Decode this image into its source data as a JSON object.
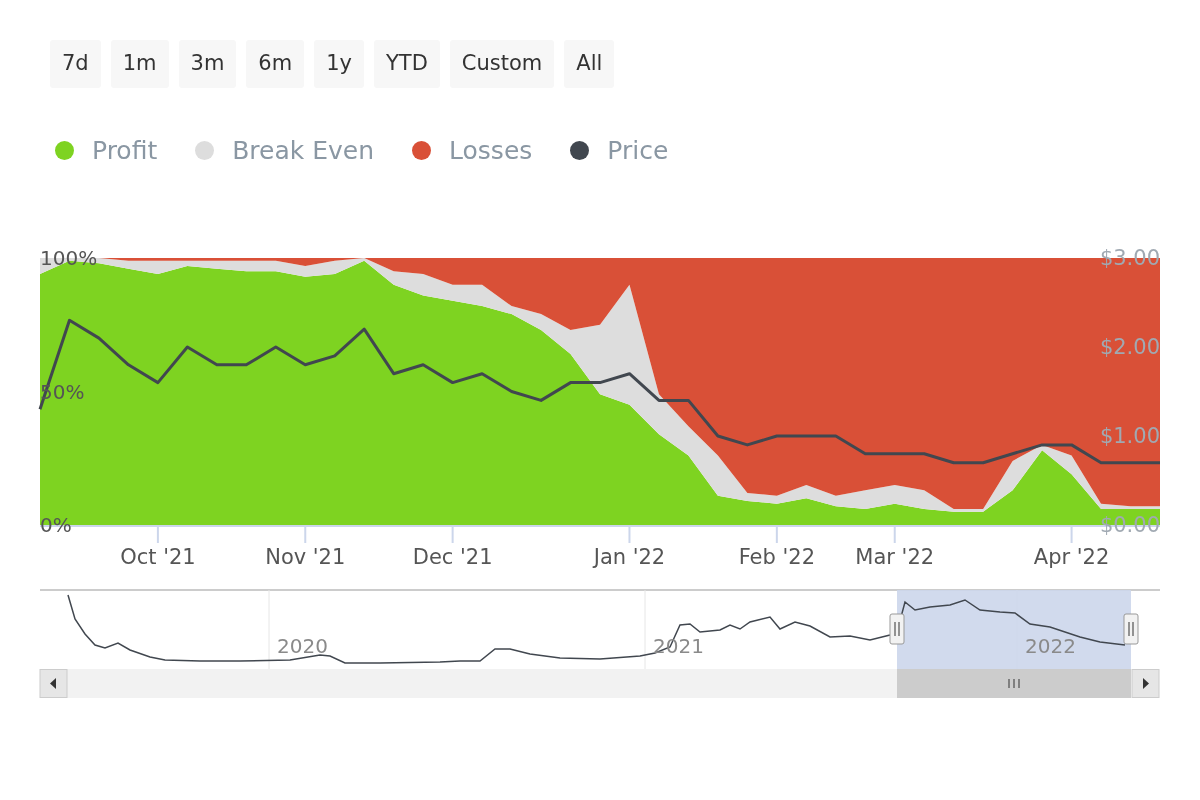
{
  "range_buttons": [
    {
      "label": "7d"
    },
    {
      "label": "1m"
    },
    {
      "label": "3m"
    },
    {
      "label": "6m"
    },
    {
      "label": "1y"
    },
    {
      "label": "YTD"
    },
    {
      "label": "Custom"
    },
    {
      "label": "All"
    }
  ],
  "chart_data": {
    "type": "area",
    "stacked": true,
    "categories": [
      null,
      null,
      null,
      null,
      "Oct '21",
      null,
      null,
      null,
      null,
      "Nov '21",
      null,
      null,
      null,
      null,
      "Dec '21",
      null,
      null,
      null,
      null,
      null,
      "Jan '22",
      null,
      null,
      null,
      null,
      "Feb '22",
      null,
      null,
      null,
      "Mar '22",
      null,
      null,
      null,
      null,
      null,
      "Apr '22",
      null,
      null,
      null
    ],
    "ylim": [
      0,
      100
    ],
    "yticks": [
      {
        "value": 0,
        "label": "0%"
      },
      {
        "value": 50,
        "label": "50%"
      },
      {
        "value": 100,
        "label": "100%"
      }
    ],
    "y2lim": [
      0,
      3
    ],
    "y2ticks": [
      {
        "value": 0,
        "label": "$0.00"
      },
      {
        "value": 1,
        "label": "$1.00"
      },
      {
        "value": 2,
        "label": "$2.00"
      },
      {
        "value": 3,
        "label": "$3.00"
      }
    ],
    "series": [
      {
        "name": "Profit",
        "color": "#7ed321",
        "values": [
          94,
          99,
          98,
          96,
          94,
          97,
          96,
          95,
          95,
          93,
          94,
          99,
          90,
          86,
          84,
          82,
          79,
          73,
          64,
          49,
          45,
          34,
          26,
          11,
          9,
          8,
          10,
          7,
          6,
          8,
          6,
          5,
          5,
          13,
          28,
          19,
          6,
          6,
          6
        ]
      },
      {
        "name": "Break Even",
        "color": "#dddddd",
        "values": [
          6,
          1,
          2,
          3,
          5,
          2,
          3,
          4,
          4,
          4,
          5,
          1,
          5,
          8,
          6,
          8,
          3,
          6,
          9,
          26,
          45,
          15,
          11,
          15,
          3,
          3,
          5,
          4,
          7,
          7,
          7,
          1,
          1,
          11,
          2,
          7,
          2,
          1,
          1
        ]
      },
      {
        "name": "Losses",
        "color": "#d95037",
        "values": [
          0,
          0,
          0,
          1,
          1,
          1,
          1,
          1,
          1,
          3,
          1,
          0,
          5,
          6,
          10,
          10,
          18,
          21,
          27,
          25,
          10,
          51,
          63,
          74,
          88,
          89,
          85,
          89,
          87,
          85,
          87,
          94,
          94,
          76,
          70,
          74,
          92,
          93,
          93
        ]
      },
      {
        "name": "Price",
        "color": "#41474f",
        "type": "line",
        "axis": "y2",
        "values": [
          1.3,
          2.3,
          2.1,
          1.8,
          1.6,
          2.0,
          1.8,
          1.8,
          2.0,
          1.8,
          1.9,
          2.2,
          1.7,
          1.8,
          1.6,
          1.7,
          1.5,
          1.4,
          1.6,
          1.6,
          1.7,
          1.4,
          1.4,
          1.0,
          0.9,
          1.0,
          1.0,
          1.0,
          0.8,
          0.8,
          0.8,
          0.7,
          0.7,
          0.8,
          0.9,
          0.9,
          0.7,
          0.7,
          0.7
        ]
      }
    ]
  },
  "navigator": {
    "labels": [
      "2020",
      "2021",
      "2022"
    ]
  }
}
